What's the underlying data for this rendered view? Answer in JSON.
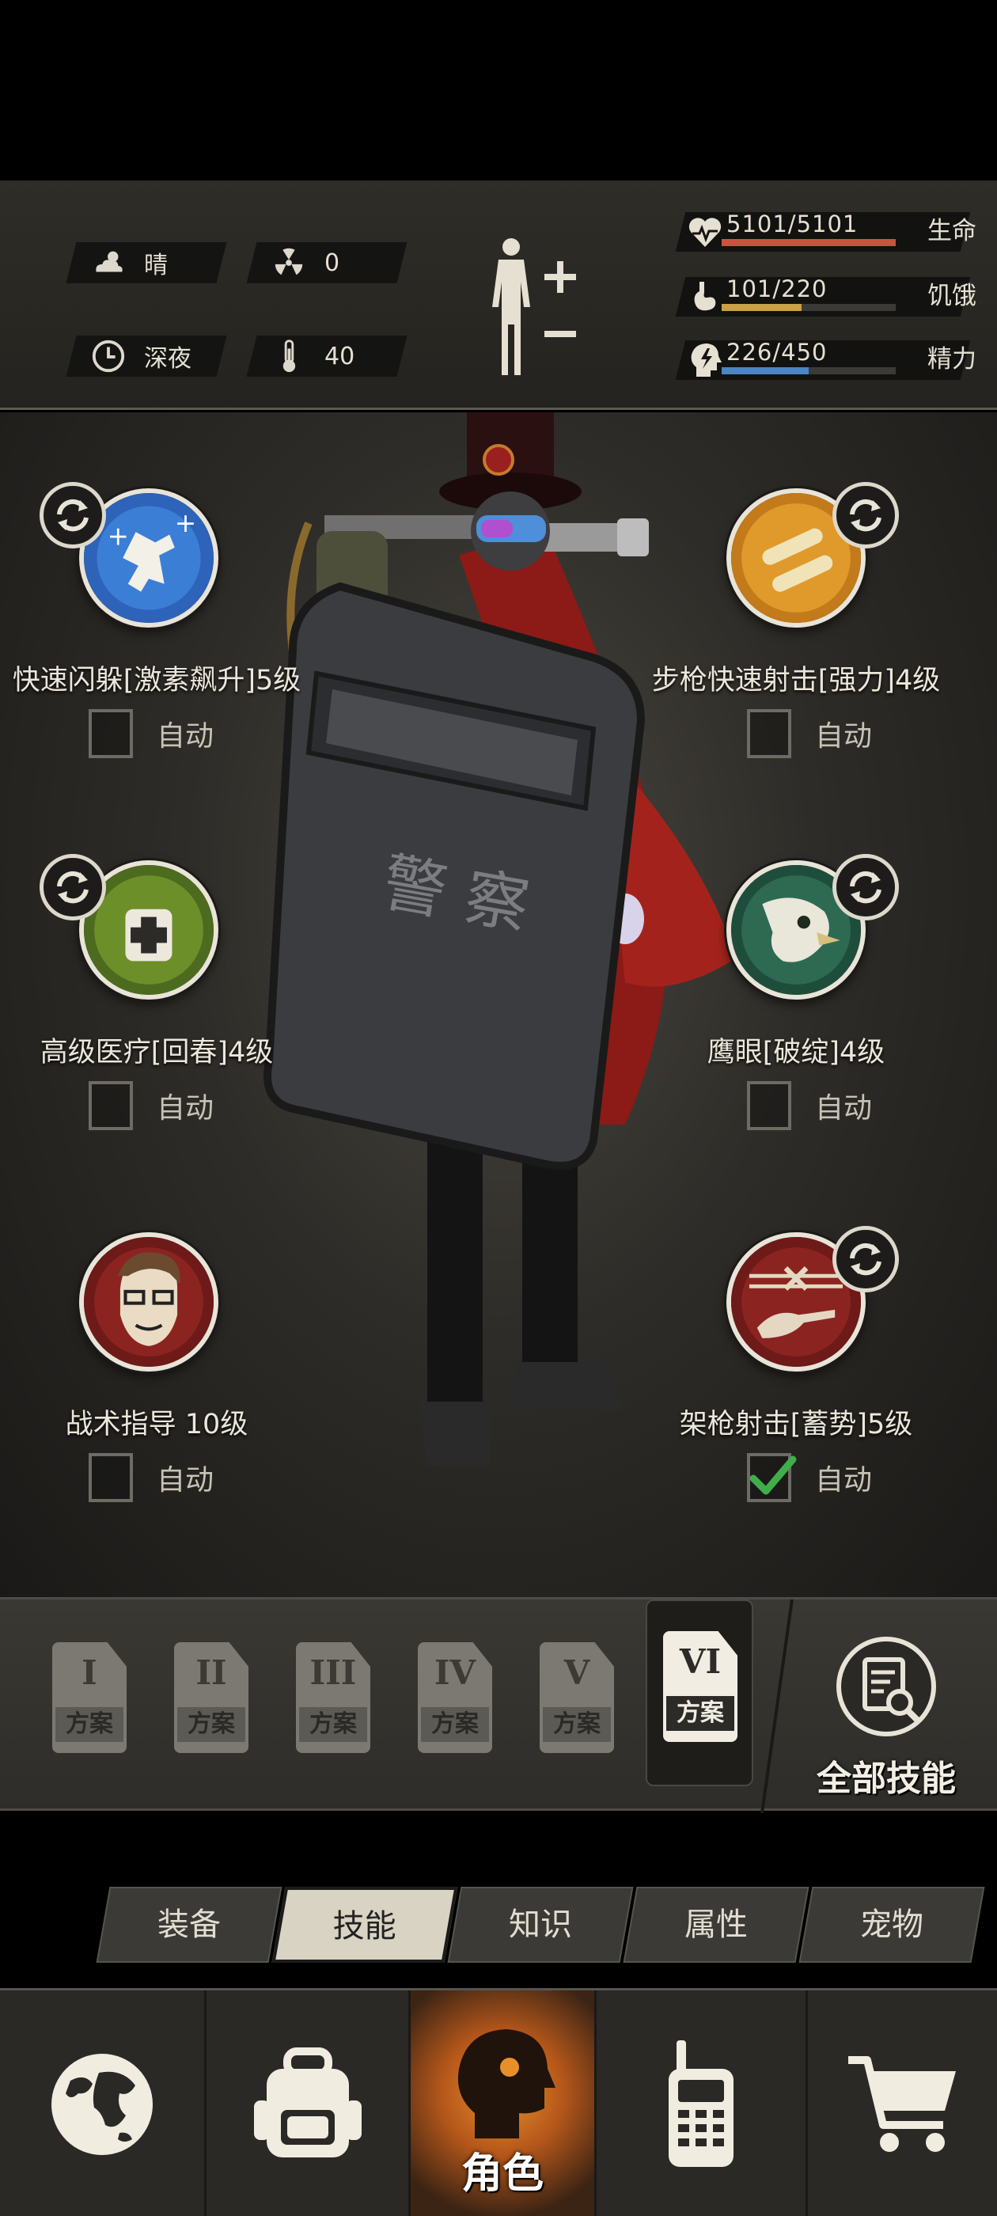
{
  "status": {
    "weather": {
      "icon": "cloud-sun-icon",
      "value": "晴"
    },
    "radiation": {
      "icon": "radiation-icon",
      "value": "0"
    },
    "time": {
      "icon": "clock-icon",
      "value": "深夜"
    },
    "temperature": {
      "icon": "thermometer-icon",
      "value": "40"
    }
  },
  "vitals": [
    {
      "icon": "heart-rate-icon",
      "value": "5101/5101",
      "name": "生命",
      "fraction": 1.0,
      "color": "#c9533e"
    },
    {
      "icon": "stomach-icon",
      "value": "101/220",
      "name": "饥饿",
      "fraction": 0.46,
      "color": "#c9a043"
    },
    {
      "icon": "head-lightning-icon",
      "value": "226/450",
      "name": "精力",
      "fraction": 0.5,
      "color": "#4b86c3"
    }
  ],
  "skills": [
    {
      "name": "快速闪躲[激素飙升]5级",
      "auto_label": "自动",
      "auto": false,
      "icon": "dodge-skill-icon",
      "swappable": true
    },
    {
      "name": "步枪快速射击[强力]4级",
      "auto_label": "自动",
      "auto": false,
      "icon": "rifle-rapid-fire-skill-icon",
      "swappable": true
    },
    {
      "name": "高级医疗[回春]4级",
      "auto_label": "自动",
      "auto": false,
      "icon": "advanced-medical-skill-icon",
      "swappable": true
    },
    {
      "name": "鹰眼[破绽]4级",
      "auto_label": "自动",
      "auto": false,
      "icon": "eagle-eye-skill-icon",
      "swappable": true
    },
    {
      "name": "战术指导 10级",
      "auto_label": "自动",
      "auto": false,
      "icon": "tactical-guidance-skill-icon",
      "swappable": false
    },
    {
      "name": "架枪射击[蓄势]5级",
      "auto_label": "自动",
      "auto": true,
      "icon": "mounted-shooting-skill-icon",
      "swappable": true
    }
  ],
  "plans": [
    {
      "numeral": "I",
      "tag": "方案",
      "active": false
    },
    {
      "numeral": "II",
      "tag": "方案",
      "active": false
    },
    {
      "numeral": "III",
      "tag": "方案",
      "active": false
    },
    {
      "numeral": "IV",
      "tag": "方案",
      "active": false
    },
    {
      "numeral": "V",
      "tag": "方案",
      "active": false
    },
    {
      "numeral": "VI",
      "tag": "方案",
      "active": true
    }
  ],
  "all_skills_label": "全部技能",
  "sub_tabs": [
    "装备",
    "技能",
    "知识",
    "属性",
    "宠物"
  ],
  "active_sub_tab": "技能",
  "nav": {
    "world": "globe-icon",
    "backpack": "backpack-icon",
    "role": {
      "icon": "head-silhouette-icon",
      "label": "角色"
    },
    "radio": "walkie-talkie-icon",
    "shop": "shopping-cart-icon"
  },
  "colors": {
    "accent": "#e98f2a",
    "check": "#3fae4a"
  }
}
